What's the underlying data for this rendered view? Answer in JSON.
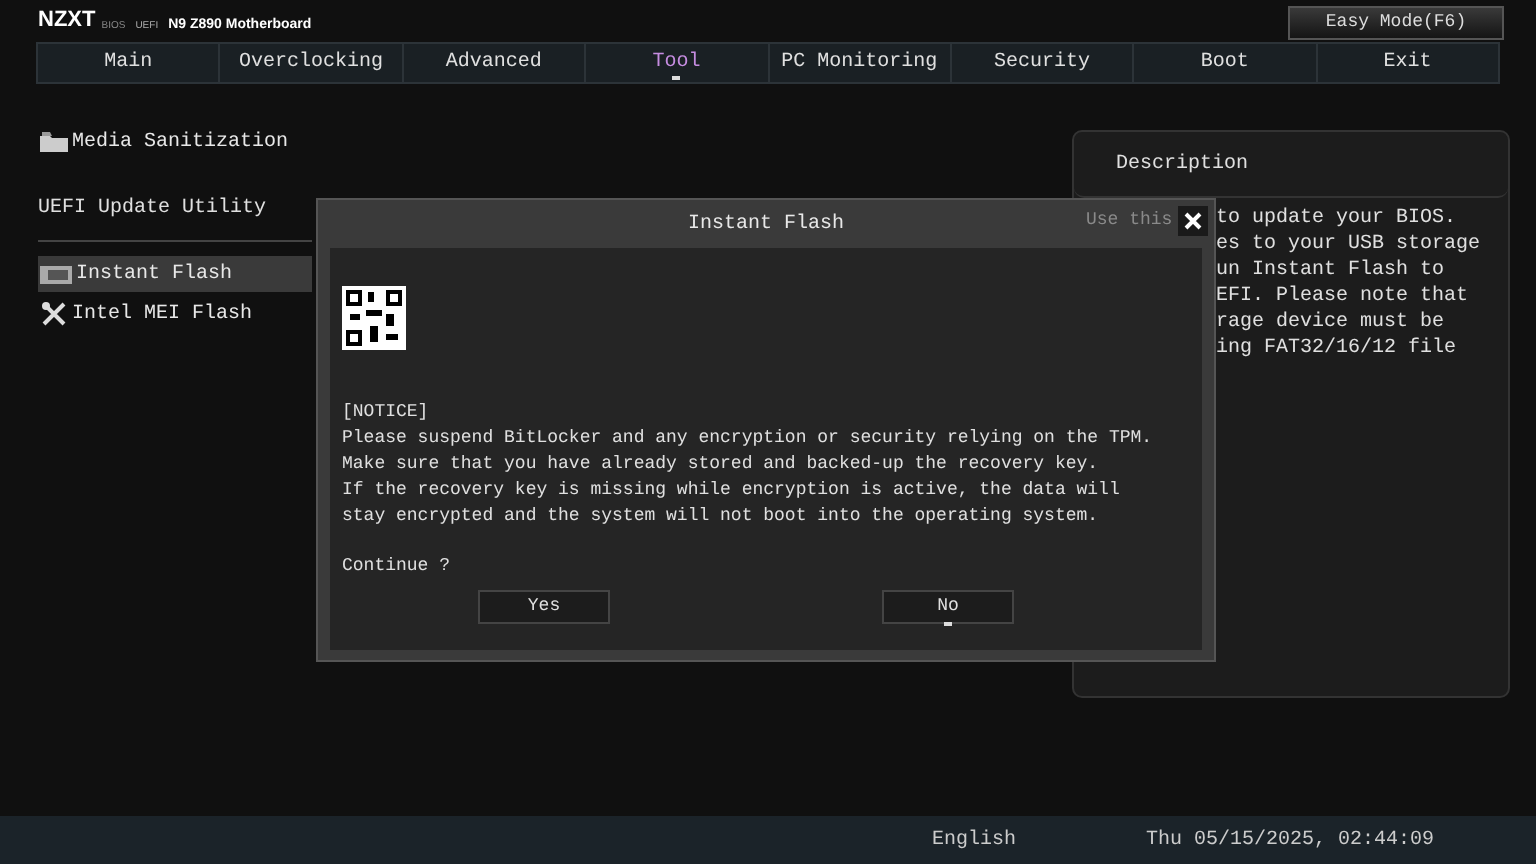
{
  "header": {
    "brand": "NZXT",
    "bios_tag": "BIOS",
    "uefi_tag": "UEFI",
    "model": "N9 Z890 Motherboard",
    "mode_button": "Easy Mode(F6)"
  },
  "tabs": [
    {
      "label": "Main",
      "selected": false
    },
    {
      "label": "Overclocking",
      "selected": false
    },
    {
      "label": "Advanced",
      "selected": false
    },
    {
      "label": "Tool",
      "selected": true
    },
    {
      "label": "PC Monitoring",
      "selected": false
    },
    {
      "label": "Security",
      "selected": false
    },
    {
      "label": "Boot",
      "selected": false
    },
    {
      "label": "Exit",
      "selected": false
    }
  ],
  "menu": [
    {
      "kind": "item",
      "label": "Media Sanitization",
      "selected": false
    },
    {
      "kind": "heading",
      "label": "UEFI Update Utility"
    },
    {
      "kind": "item",
      "label": "Instant Flash",
      "selected": true
    },
    {
      "kind": "item",
      "label": "Intel MEI Flash",
      "selected": false
    }
  ],
  "description": {
    "title": "Description",
    "covered_text": "Use this",
    "lines": [
      "to update your BIOS.",
      "es to your USB storage",
      "un Instant Flash to",
      "EFI. Please note that",
      "rage device must be",
      "ing FAT32/16/12 file"
    ]
  },
  "dialog": {
    "title": "Instant Flash",
    "notice": "[NOTICE]",
    "message": [
      "Please suspend BitLocker and any encryption or security relying on the TPM.",
      "Make sure that you have already stored and backed-up the recovery key.",
      "If the recovery key is missing while encryption is active, the data will",
      "stay encrypted and the system will not boot into the operating system."
    ],
    "question": "Continue ?",
    "buttons": [
      {
        "label": "Yes",
        "selected": false
      },
      {
        "label": "No",
        "selected": true
      }
    ]
  },
  "status_bar": {
    "language": "English",
    "datetime": "Thu 05/15/2025, 02:44:09"
  }
}
